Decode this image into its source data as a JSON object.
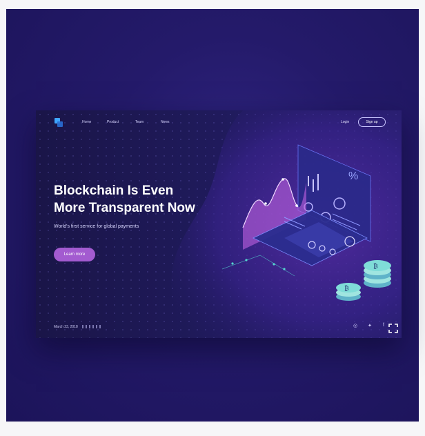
{
  "nav": {
    "items": [
      "Home",
      "Product",
      "Team",
      "News"
    ],
    "login": "Login",
    "signup": "Sign up"
  },
  "hero": {
    "headline_line1": "Blockchain Is Even",
    "headline_line2": "More Transparent Now",
    "subtitle": "World's first service for global payments",
    "cta": "Learn more"
  },
  "footer": {
    "date": "March 23, 2018",
    "social_icons": [
      "instagram-icon",
      "twitter-icon",
      "facebook-icon"
    ],
    "social_glyphs": [
      "◎",
      "✦",
      "f"
    ]
  },
  "colors": {
    "background": "#1c145a",
    "card": "#1f1a5a",
    "accent": "#a35bd0",
    "logo_primary": "#3fa6ff",
    "logo_secondary": "#2a6fd6",
    "coin": "#7fdcd8"
  },
  "illustration": {
    "coin_symbol": "₿",
    "percent_symbol": "%"
  }
}
